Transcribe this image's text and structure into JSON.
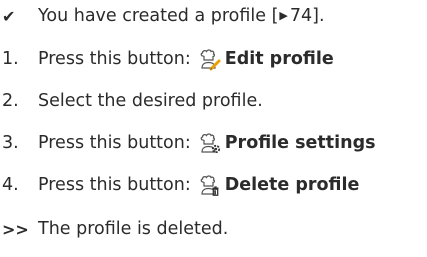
{
  "prerequisite": {
    "marker": "✔",
    "text_before_ref": "You have created a profile [",
    "ref_arrow": "▶",
    "ref_page": " 74",
    "text_after_ref": "]."
  },
  "steps": [
    {
      "number": "1.",
      "text": "Press this button: ",
      "icon": "chef-edit-icon",
      "button_label": "Edit profile"
    },
    {
      "number": "2.",
      "text": "Select the desired profile."
    },
    {
      "number": "3.",
      "text": "Press this button: ",
      "icon": "chef-settings-icon",
      "button_label": "Profile settings"
    },
    {
      "number": "4.",
      "text": "Press this button: ",
      "icon": "chef-delete-icon",
      "button_label": "Delete profile"
    }
  ],
  "result": {
    "marker": ">>",
    "text": "The profile is deleted."
  },
  "colors": {
    "text": "#2b2b2b",
    "icon_outline": "#555555",
    "icon_accent": "#e8a300"
  }
}
